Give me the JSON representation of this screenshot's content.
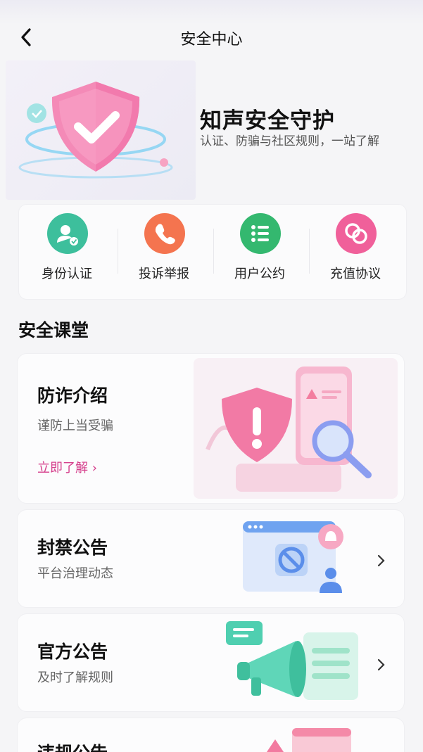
{
  "header": {
    "title": "安全中心"
  },
  "hero": {
    "title": "知声安全守护",
    "subtitle": "认证、防骗与社区规则，一站了解"
  },
  "quick_actions": [
    {
      "label": "身份认证",
      "color": "#3dbf9c",
      "icon": "id-verify-icon"
    },
    {
      "label": "投诉举报",
      "color": "#f4744f",
      "icon": "phone-icon"
    },
    {
      "label": "用户公约",
      "color": "#34b86f",
      "icon": "list-icon"
    },
    {
      "label": "充值协议",
      "color": "#f0609a",
      "icon": "link-rings-icon"
    }
  ],
  "section": {
    "title": "安全课堂"
  },
  "cards": [
    {
      "title": "防诈介绍",
      "subtitle": "谨防上当受骗",
      "link": "立即了解 ›"
    },
    {
      "title": "封禁公告",
      "subtitle": "平台治理动态"
    },
    {
      "title": "官方公告",
      "subtitle": "及时了解规则"
    },
    {
      "title": "违规公告"
    }
  ],
  "colors": {
    "accent": "#d53f8c",
    "background": "#f5f5f7"
  }
}
